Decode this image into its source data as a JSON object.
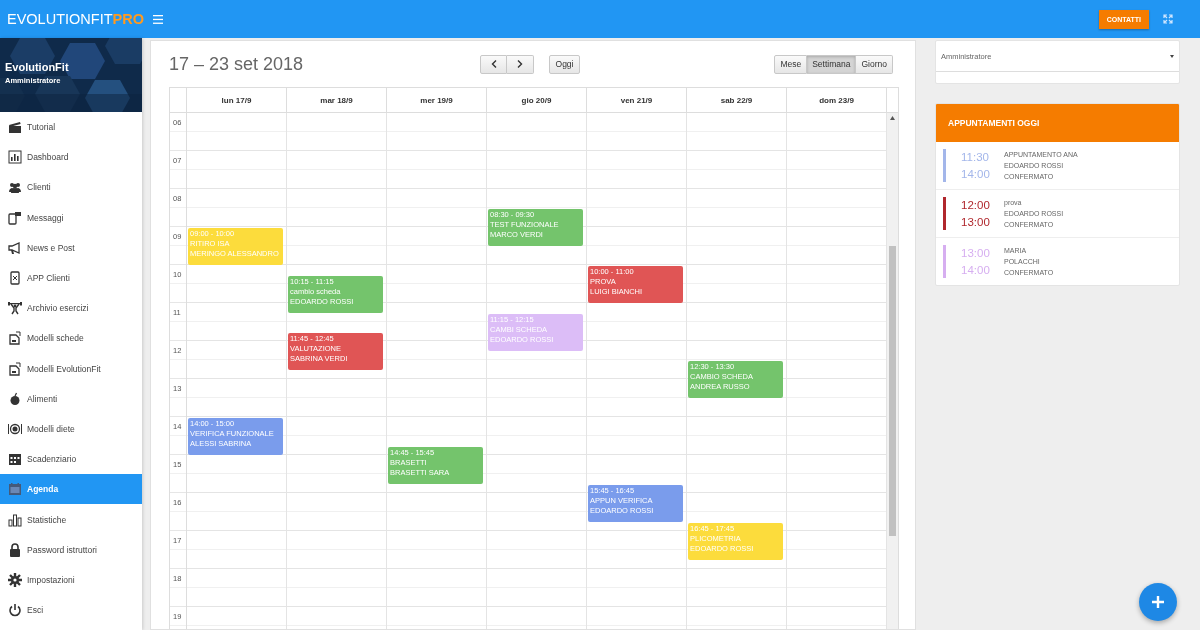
{
  "topbar": {
    "logo": "EVOLUTIONFIT",
    "logo_accent": "PRO",
    "contact_button": "CONTATTI"
  },
  "sidebar": {
    "profile": {
      "name": "EvolutionFit",
      "role": "Amministratore"
    },
    "items": [
      {
        "label": "Tutorial",
        "selected": false
      },
      {
        "label": "Dashboard",
        "selected": false
      },
      {
        "label": "Clienti",
        "selected": false
      },
      {
        "label": "Messaggi",
        "selected": false
      },
      {
        "label": "News e Post",
        "selected": false
      },
      {
        "label": "APP Clienti",
        "selected": false
      },
      {
        "label": "Archivio esercizi",
        "selected": false
      },
      {
        "label": "Modelli schede",
        "selected": false
      },
      {
        "label": "Modelli EvolutionFit",
        "selected": false
      },
      {
        "label": "Alimenti",
        "selected": false
      },
      {
        "label": "Modelli diete",
        "selected": false
      },
      {
        "label": "Scadenziario",
        "selected": false
      },
      {
        "label": "Agenda",
        "selected": true
      },
      {
        "label": "Statistiche",
        "selected": false
      },
      {
        "label": "Password istruttori",
        "selected": false
      },
      {
        "label": "Impostazioni",
        "selected": false
      },
      {
        "label": "Esci",
        "selected": false
      }
    ]
  },
  "calendar": {
    "title": "17 – 23 set 2018",
    "today_button": "Oggi",
    "views": [
      {
        "label": "Mese",
        "selected": false
      },
      {
        "label": "Settimana",
        "selected": true
      },
      {
        "label": "Giorno",
        "selected": false
      }
    ],
    "hours": [
      "06",
      "07",
      "08",
      "09",
      "10",
      "11",
      "12",
      "13",
      "14",
      "15",
      "16",
      "17",
      "18",
      "19"
    ],
    "days": [
      {
        "label": "lun 17/9",
        "events": [
          {
            "time": "09:00 - 10:00",
            "title": "RITIRO ISA",
            "client": "MERINGO ALESSANDRO",
            "color": "#fcdc3c"
          },
          {
            "time": "14:00 - 15:00",
            "title": "VERIFICA FUNZIONALE",
            "client": "ALESSI SABRINA",
            "color": "#7a9cec"
          }
        ]
      },
      {
        "label": "mar 18/9",
        "events": [
          {
            "time": "10:15 - 11:15",
            "title": "cambio scheda",
            "client": "EDOARDO ROSSI",
            "color": "#74c46c"
          },
          {
            "time": "11:45 - 12:45",
            "title": "VALUTAZIONE",
            "client": "SABRINA VERDI",
            "color": "#e05555"
          }
        ]
      },
      {
        "label": "mer 19/9",
        "events": [
          {
            "time": "14:45 - 15:45",
            "title": "BRASETTI",
            "client": "BRASETTI SARA",
            "color": "#74c46c"
          }
        ]
      },
      {
        "label": "gio 20/9",
        "events": [
          {
            "time": "08:30 - 09:30",
            "title": "TEST FUNZIONALE",
            "client": "MARCO VERDI",
            "color": "#74c46c"
          },
          {
            "time": "11:15 - 12:15",
            "title": "CAMBI SCHEDA",
            "client": "EDOARDO ROSSI",
            "color": "#dcbdf7"
          }
        ]
      },
      {
        "label": "ven 21/9",
        "events": [
          {
            "time": "10:00 - 11:00",
            "title": "PROVA",
            "client": "LUIGI BIANCHI",
            "color": "#e05555"
          },
          {
            "time": "15:45 - 16:45",
            "title": "APPUN VERIFICA",
            "client": "EDOARDO ROSSI",
            "color": "#7a9cec"
          }
        ]
      },
      {
        "label": "sab 22/9",
        "events": [
          {
            "time": "12:30 - 13:30",
            "title": "CAMBIO SCHEDA",
            "client": "ANDREA RUSSO",
            "color": "#74c46c"
          },
          {
            "time": "16:45 - 17:45",
            "title": "PLICOMETRIA",
            "client": "EDOARDO ROSSI",
            "color": "#fcdc3c"
          }
        ]
      },
      {
        "label": "dom 23/9"
      }
    ]
  },
  "right": {
    "user_select": {
      "value": "Amministratore"
    },
    "appointments": {
      "title": "APPUNTAMENTI OGGI",
      "items": [
        {
          "start": "11:30",
          "end": "14:00",
          "title": "APPUNTAMENTO ANA",
          "client": "EDOARDO ROSSI",
          "status": "CONFERMATO",
          "color": "#a3b6ea"
        },
        {
          "start": "12:00",
          "end": "13:00",
          "title": "prova",
          "client": "EDOARDO ROSSI",
          "status": "CONFERMATO",
          "color": "#b0272d"
        },
        {
          "start": "13:00",
          "end": "14:00",
          "title": "MARIA",
          "client": "POLACCHI",
          "status": "CONFERMATO",
          "color": "#d6aef0"
        }
      ]
    }
  }
}
